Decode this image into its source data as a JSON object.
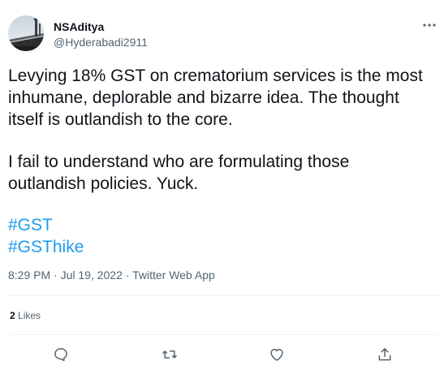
{
  "author": {
    "name": "NSAditya",
    "handle": "@Hyderabadi2911"
  },
  "tweet": {
    "paragraphs": [
      [
        "Levying 18% GST on crematorium services is the most",
        "inhumane, deplorable and bizarre idea. The thought",
        "itself is outlandish to the core."
      ],
      [
        "I fail to understand who are formulating those",
        "outlandish policies. Yuck."
      ]
    ],
    "hashtags": [
      "#GST",
      "#GSThike"
    ]
  },
  "meta": {
    "time": "8:29 PM",
    "separator": "·",
    "date": "Jul 19, 2022",
    "source": "Twitter Web App"
  },
  "stats": {
    "likes_count": "2",
    "likes_label": "Likes"
  },
  "icons": {
    "more": "more-horizontal-icon",
    "reply": "reply-icon",
    "retweet": "retweet-icon",
    "like": "heart-icon",
    "share": "share-icon"
  },
  "colors": {
    "text": "#0f1419",
    "secondary": "#536471",
    "link": "#1d9bf0",
    "divider": "#eff3f4"
  }
}
